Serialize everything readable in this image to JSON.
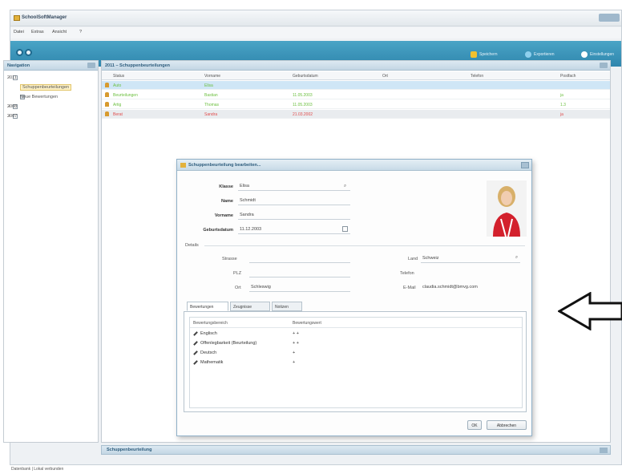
{
  "app": {
    "title": "SchoolSoftManager"
  },
  "menu": [
    "Datei",
    "Extras",
    "Ansicht",
    "?"
  ],
  "toolbar": {
    "actions": [
      {
        "label": "Speichern",
        "icon": "shield-icon",
        "color": "#f2c12e"
      },
      {
        "label": "Exportieren",
        "icon": "export-icon",
        "color": "#8fd0ee"
      },
      {
        "label": "Einstellungen",
        "icon": "settings-icon",
        "color": "#ffffff"
      }
    ]
  },
  "sidebar": {
    "title": "Navigation",
    "tree": [
      {
        "label": "2011",
        "expander": "−",
        "icon": "calendar-icon",
        "indent": 0
      },
      {
        "label": "Schuppenbeurteilungen",
        "expander": "",
        "icon": "person-icon",
        "indent": 1,
        "selected": true
      },
      {
        "label": "Neue Bewertungen",
        "expander": "",
        "icon": "note-icon",
        "indent": 1
      },
      {
        "label": "2008",
        "expander": "+",
        "icon": "calendar-icon",
        "indent": 0
      },
      {
        "label": "2007",
        "expander": "+",
        "icon": "calendar-icon",
        "indent": 0
      }
    ]
  },
  "main": {
    "title": "2011 – Schuppenbeurteilungen",
    "columns": [
      "Status",
      "Vorname",
      "Geburtsdatum",
      "Ort",
      "Telefon",
      "Postfach"
    ],
    "rows": [
      {
        "cells": [
          "Auto",
          "Elisa",
          "",
          "",
          "",
          ""
        ],
        "color": "#6bbf3e"
      },
      {
        "cells": [
          "Beurteilungen",
          "Bastian",
          "11.05.2003",
          "",
          "",
          "ja"
        ],
        "color": "#6bbf3e"
      },
      {
        "cells": [
          "Artig",
          "Thomas",
          "11.05.2003",
          "",
          "",
          "1.3"
        ],
        "color": "#6bbf3e"
      },
      {
        "cells": [
          "Berat",
          "Sandra",
          "21.03.2002",
          "",
          "",
          "ja"
        ],
        "color": "#e04b4b"
      }
    ]
  },
  "dialog": {
    "title": "Schuppenbeurteilung bearbeiten...",
    "fields": {
      "klasse_label": "Klasse",
      "klasse_value": "Elisa",
      "name_label": "Name",
      "name_value": "Schmidt",
      "vorname_label": "Vorname",
      "vorname_value": "Sandra",
      "geburtsdatum_label": "Geburtsdatum",
      "geburtsdatum_value": "11.12.2003"
    },
    "details_label": "Details",
    "strasse_label": "Strasse",
    "strasse_value": "",
    "plz_label": "PLZ",
    "plz_value": "",
    "ort_label": "Ort",
    "ort_value": "Schleswig",
    "land_label": "Land",
    "land_value": "Schweiz",
    "telefon_label": "Telefon",
    "telefon_value": "",
    "email_label": "E-Mail",
    "email_value": "claudia.schmidt@bmvg.com",
    "tabs": [
      "Bewertungen",
      "Zeugnisse",
      "Notizen"
    ],
    "grid_headers": [
      "Bewertungsbereich",
      "Bewertungswert"
    ],
    "grid_rows": [
      {
        "name": "Englisch",
        "value": "+ +"
      },
      {
        "name": "Offenlegbarkeit (Beurteilung)",
        "value": "+ +"
      },
      {
        "name": "Deutsch",
        "value": "+"
      },
      {
        "name": "Mathematik",
        "value": "+"
      }
    ],
    "ok_label": "OK",
    "cancel_label": "Abbrechen"
  },
  "bottom_panel": {
    "title": "Schuppenbeurteilung"
  },
  "status": "Datenbank | Lokal verbunden"
}
